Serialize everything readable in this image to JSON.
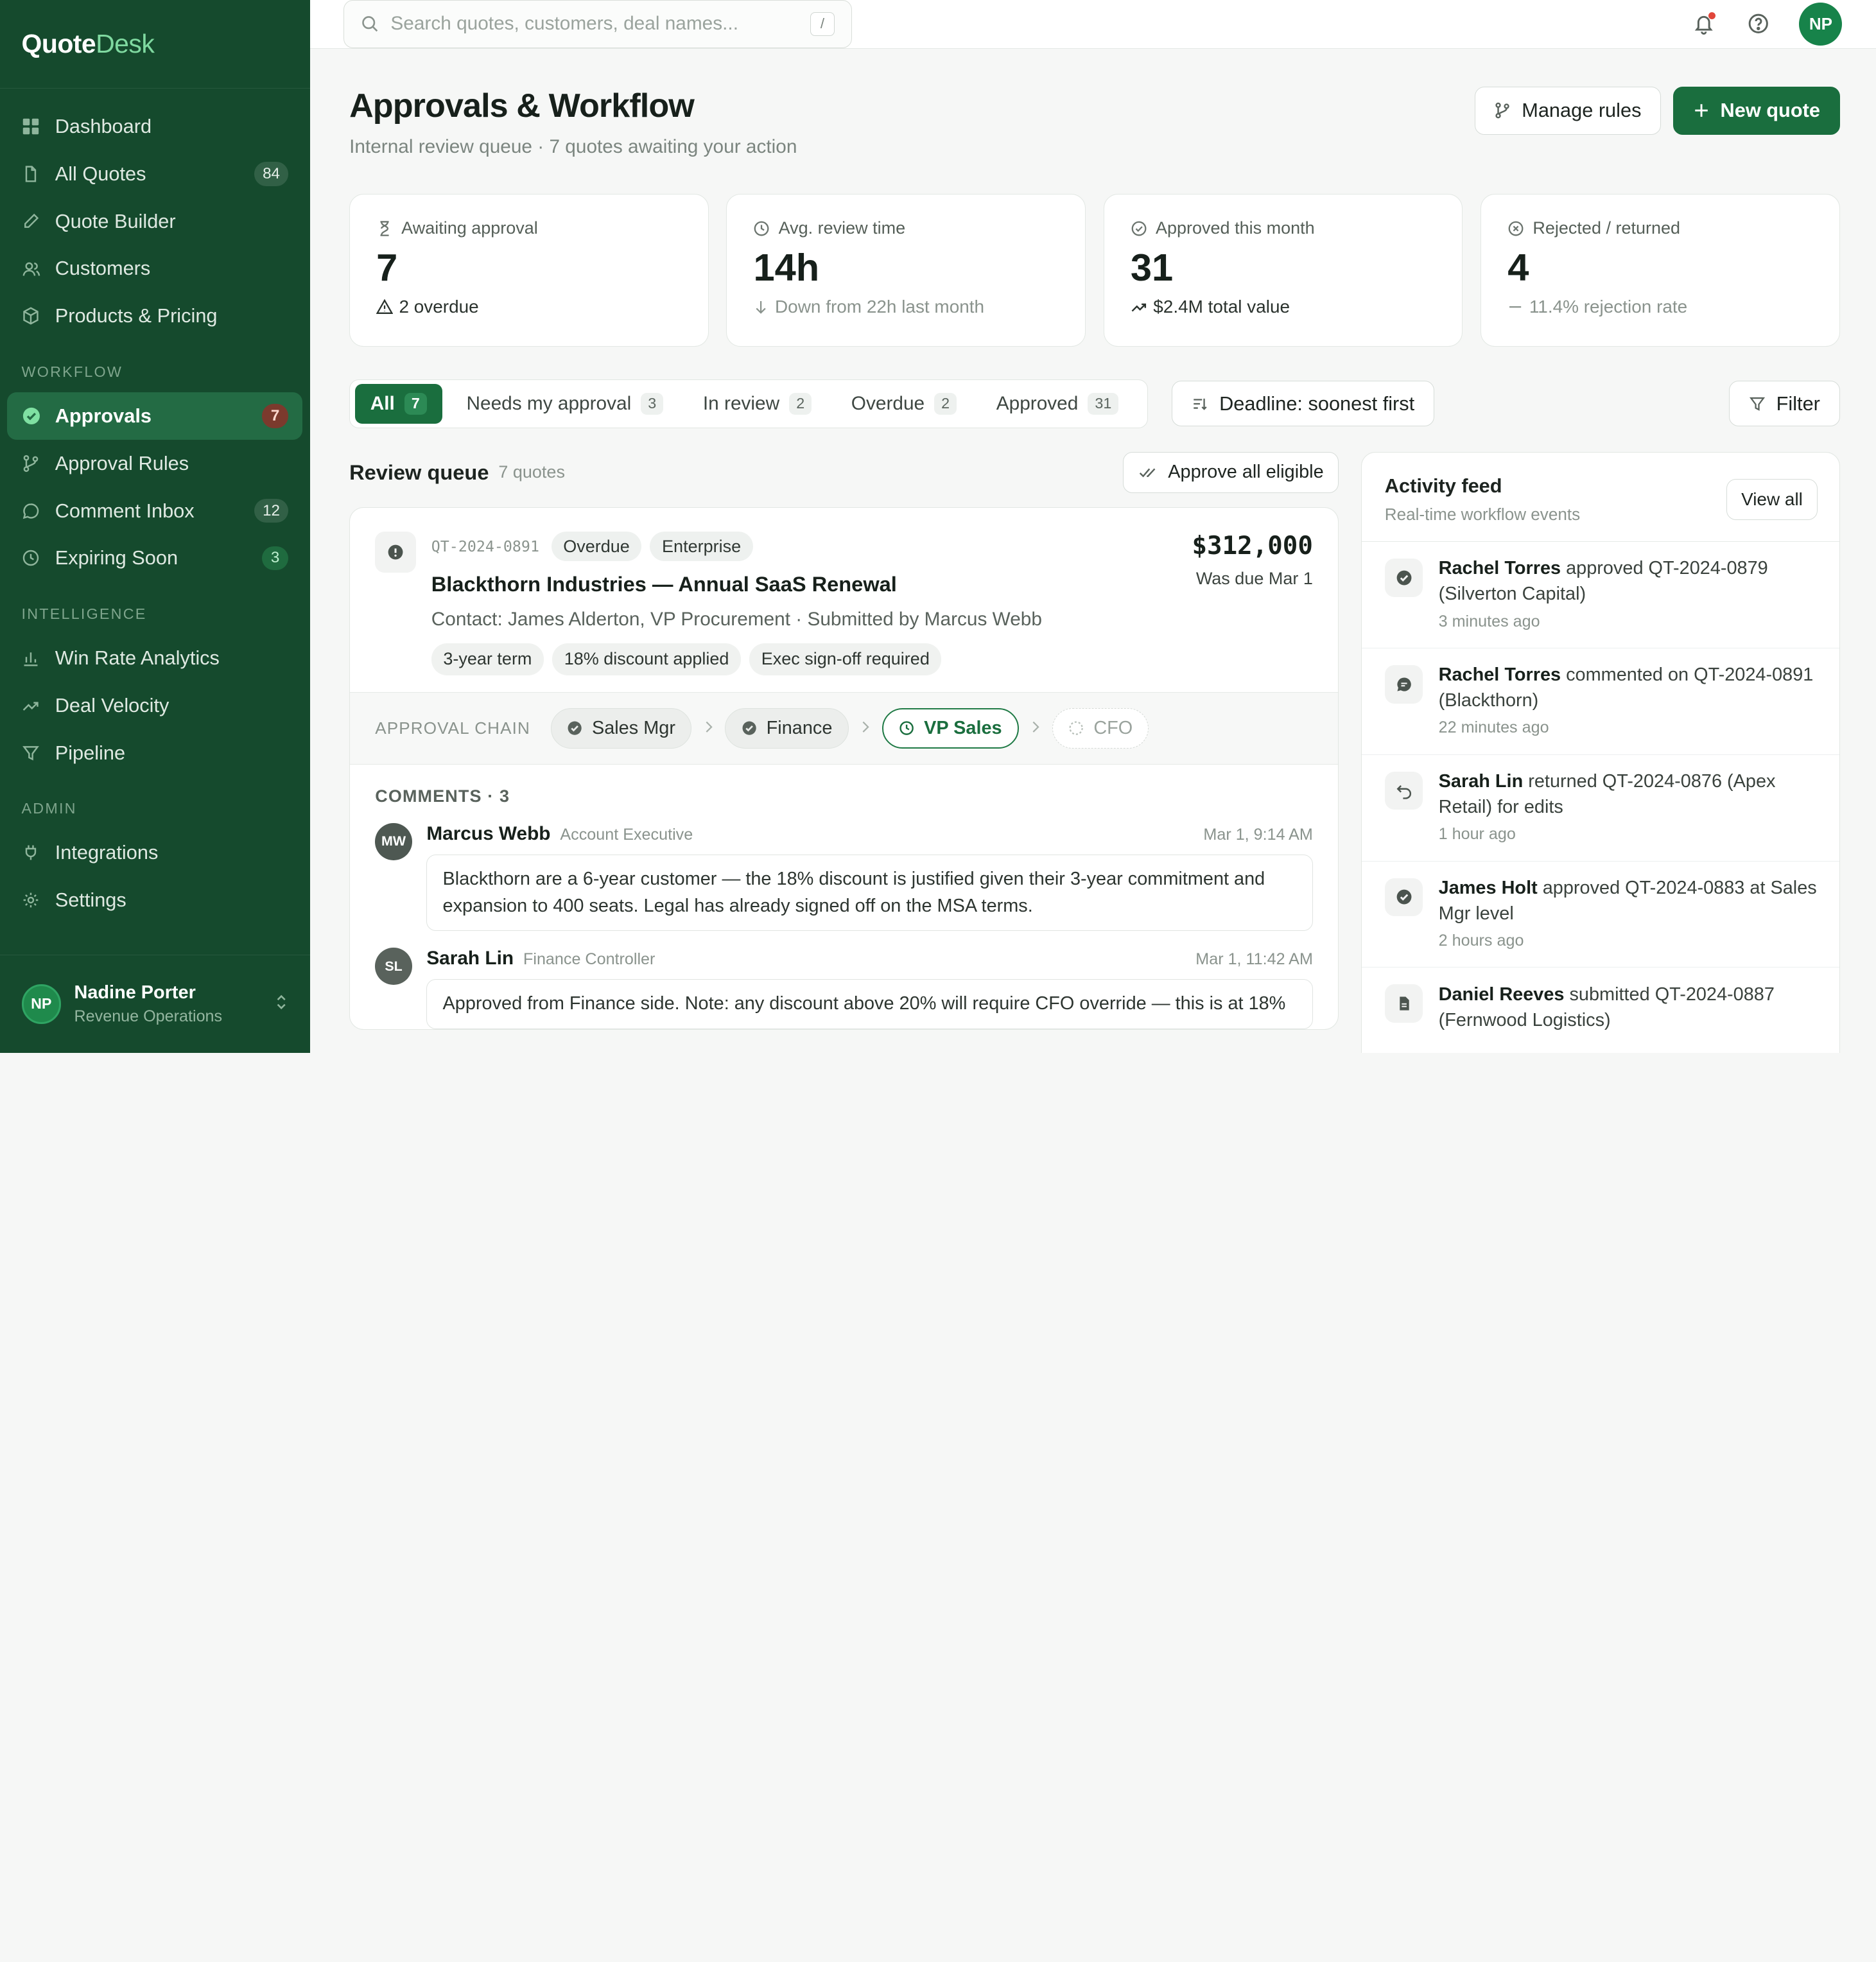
{
  "brand": {
    "part1": "Quote",
    "part2": "Desk"
  },
  "sidebar": {
    "items": [
      {
        "label": "Dashboard",
        "icon": "grid-icon"
      },
      {
        "label": "All Quotes",
        "count": "84",
        "icon": "document-icon"
      },
      {
        "label": "Quote Builder",
        "icon": "pencil-icon"
      },
      {
        "label": "Customers",
        "icon": "users-icon"
      },
      {
        "label": "Products & Pricing",
        "icon": "package-icon"
      }
    ],
    "sections": {
      "workflow": "WORKFLOW",
      "intelligence": "INTELLIGENCE",
      "admin": "ADMIN"
    },
    "workflow_items": [
      {
        "label": "Approvals",
        "count": "7",
        "icon": "check-circle-icon"
      },
      {
        "label": "Approval Rules",
        "icon": "branch-icon"
      },
      {
        "label": "Comment Inbox",
        "count": "12",
        "icon": "comment-icon"
      },
      {
        "label": "Expiring Soon",
        "count": "3",
        "icon": "clock-icon"
      }
    ],
    "intelligence_items": [
      {
        "label": "Win Rate Analytics",
        "icon": "bar-chart-icon"
      },
      {
        "label": "Deal Velocity",
        "icon": "trend-icon"
      },
      {
        "label": "Pipeline",
        "icon": "funnel-icon"
      }
    ],
    "admin_items": [
      {
        "label": "Integrations",
        "icon": "plug-icon"
      },
      {
        "label": "Settings",
        "icon": "gear-icon"
      }
    ],
    "user": {
      "initials": "NP",
      "name": "Nadine Porter",
      "role": "Revenue Operations"
    }
  },
  "topbar": {
    "search_placeholder": "Search quotes, customers, deal names...",
    "shortcut": "/",
    "avatar": "NP"
  },
  "header": {
    "title": "Approvals & Workflow",
    "subtitle": "Internal review queue · 7 quotes awaiting your action",
    "manage_rules": "Manage rules",
    "new_quote": "New quote"
  },
  "kpis": [
    {
      "label": "Awaiting approval",
      "value": "7",
      "note": "2 overdue"
    },
    {
      "label": "Avg. review time",
      "value": "14h",
      "note": "Down from 22h last month"
    },
    {
      "label": "Approved this month",
      "value": "31",
      "note": "$2.4M total value"
    },
    {
      "label": "Rejected / returned",
      "value": "4",
      "note": "11.4% rejection rate"
    }
  ],
  "tabs": [
    {
      "label": "All",
      "count": "7"
    },
    {
      "label": "Needs my approval",
      "count": "3"
    },
    {
      "label": "In review",
      "count": "2"
    },
    {
      "label": "Overdue",
      "count": "2"
    },
    {
      "label": "Approved",
      "count": "31"
    }
  ],
  "sort_label": "Deadline: soonest first",
  "filter_label": "Filter",
  "queue": {
    "title": "Review queue",
    "count": "7 quotes",
    "approve_all": "Approve all eligible",
    "card": {
      "id": "QT-2024-0891",
      "badges": [
        "Overdue",
        "Enterprise"
      ],
      "title": "Blackthorn Industries — Annual SaaS Renewal",
      "contact": "Contact: James Alderton, VP Procurement · Submitted by Marcus Webb",
      "chips": [
        "3-year term",
        "18% discount applied",
        "Exec sign-off required"
      ],
      "amount": "$312,000",
      "due": "Was due Mar 1",
      "chain_label": "APPROVAL CHAIN",
      "chain": [
        "Sales Mgr",
        "Finance",
        "VP Sales",
        "CFO"
      ],
      "comments_title": "COMMENTS · 3",
      "comments": [
        {
          "initials": "MW",
          "name": "Marcus Webb",
          "role": "Account Executive",
          "time": "Mar 1, 9:14 AM",
          "text": "Blackthorn are a 6-year customer — the 18% discount is justified given their 3-year commitment and expansion to 400 seats. Legal has already signed off on the MSA terms."
        },
        {
          "initials": "SL",
          "name": "Sarah Lin",
          "role": "Finance Controller",
          "time": "Mar 1, 11:42 AM",
          "text": "Approved from Finance side. Note: any discount above 20% will require CFO override — this is at 18%"
        }
      ]
    }
  },
  "feed": {
    "title": "Activity feed",
    "subtitle": "Real-time workflow events",
    "view_all": "View all",
    "events": [
      {
        "actor": "Rachel Torres",
        "text": " approved QT-2024-0879 (Silverton Capital)",
        "time": "3 minutes ago",
        "icon": "check-badge-icon"
      },
      {
        "actor": "Rachel Torres",
        "text": " commented on QT-2024-0891 (Blackthorn)",
        "time": "22 minutes ago",
        "icon": "comment-icon"
      },
      {
        "actor": "Sarah Lin",
        "text": " returned QT-2024-0876 (Apex Retail) for edits",
        "time": "1 hour ago",
        "icon": "return-icon"
      },
      {
        "actor": "James Holt",
        "text": " approved QT-2024-0883 at Sales Mgr level",
        "time": "2 hours ago",
        "icon": "check-badge-icon"
      },
      {
        "actor": "Daniel Reeves",
        "text": " submitted QT-2024-0887 (Fernwood Logistics)",
        "time": "",
        "icon": "file-icon"
      }
    ]
  }
}
